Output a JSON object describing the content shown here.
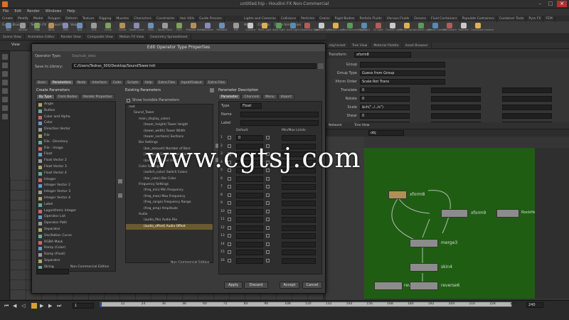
{
  "window": {
    "title": "untitled.hip - Houdini FX Non-Commercial"
  },
  "menu": [
    "File",
    "Edit",
    "Render",
    "Windows",
    "Help"
  ],
  "shelf_left": {
    "tabs": [
      "Create",
      "Modify",
      "Model",
      "Polygon",
      "Deform",
      "Texture",
      "Rigging",
      "Muscles",
      "Characters",
      "Constraints",
      "Hair Utils",
      "Guide Process",
      "Guide Brushes",
      "Terrain FX",
      "Cloud FX",
      "Volume"
    ],
    "tools": [
      "Box",
      "Sphere",
      "Tube",
      "Torus",
      "Grid",
      "Null",
      "Line",
      "Circle",
      "Curve",
      "Draw Curve",
      "Path",
      "Spray Paint",
      "Font",
      "Platonic Solids",
      "L-System",
      "Metaball",
      "File"
    ]
  },
  "shelf_right": {
    "tabs": [
      "Lights and Cameras",
      "Collisions",
      "Particles",
      "Grains",
      "Rigid Bodies",
      "Particle Fluids",
      "Viscous Fluids",
      "Oceans",
      "Fluid Containers",
      "Populate Containers",
      "Container Tools",
      "Pyro FX",
      "FEM",
      "Wires",
      "Crowds",
      "Drive Simulation"
    ],
    "tools": [
      "Camera",
      "Point Light",
      "Spot Light",
      "Area Light",
      "Geometry Light",
      "Volume Light",
      "Distant Light",
      "Environment Light",
      "Sky Light",
      "GI Light",
      "Caustic Light",
      "Portal Light",
      "Ambient Light",
      "Stereo Camera",
      "VR Camera",
      "Switcher",
      "Gamepad Camera"
    ]
  },
  "pane_tabs_left": [
    "Scene View",
    "Animation Editor",
    "Render View",
    "Composite View",
    "Motion FX View",
    "Geometry Spreadsheet"
  ],
  "pane_tabs_right": [
    "/obj/rocket",
    "Tree View",
    "Material Palette",
    "Asset Browser"
  ],
  "dialog": {
    "title": "Edit Operator Type Properties",
    "operator_type_label": "Operator Type:",
    "operator_type_value": "Sop/sub_desc",
    "save_to_library_label": "Save to Library:",
    "save_to_library_value": "C:/Users/Tedras_300/Desktop/SoundTower.hdt",
    "tabs": [
      "Basic",
      "Parameters",
      "Node",
      "Interface",
      "Code",
      "Scripts",
      "Help",
      "Extra Files",
      "Input/Output",
      "Extra Files"
    ],
    "create_params_title": "Create Parameters",
    "create_params_subtabs": [
      "By Type",
      "From Nodes",
      "Render Properties"
    ],
    "param_types": [
      "Angle",
      "Button",
      "Color and Alpha",
      "Color",
      "Direction Vector",
      "File",
      "File - Directory",
      "File - Image",
      "Float",
      "Float Vector 2",
      "Float Vector 3",
      "Float Vector 4",
      "Integer",
      "Integer Vector 2",
      "Integer Vector 3",
      "Integer Vector 4",
      "Label",
      "Logarithmic Integer",
      "Operator List",
      "Operator Path",
      "Separator",
      "Oscillation Curve",
      "RGBA Mask",
      "Ramp (Color)",
      "Ramp (Float)",
      "Separator",
      "String",
      "Toggle",
      "UV",
      "UVW"
    ],
    "create_params_footer": "Non-Commercial Edition",
    "existing_params_title": "Existing Parameters",
    "show_invisible_label": "Show Invisible Parameters",
    "tree": [
      "root",
      "Sound_Tower",
      "main_display_colors",
      "(tower_height) Tower Height",
      "(tower_width) Tower Width",
      "(tower_sections) Sections",
      "Bar Settings",
      "(bar_amount) Number of Bars",
      "(bar_gap) Gap Between Bars",
      "(bar_height) Bar Height",
      "Color Settings",
      "(switch_color) Switch Colors",
      "(bar_color) Bar Color",
      "Frequency Settings",
      "(freq_min) Min Frequency",
      "(freq_max) Max Frequency",
      "(freq_range) Frequency Range",
      "(freq_amp) Amplitude",
      "Audio",
      "(audio_file) Audio File",
      "(audio_offset) Audio Offset"
    ],
    "existing_params_footer": "Non-Commercial Edition",
    "param_desc_title": "Parameter Description",
    "param_desc_subtabs": [
      "Parameter",
      "Channels",
      "Menu",
      "Import"
    ],
    "param_desc_fields": [
      {
        "label": "Type",
        "value": "Float"
      },
      {
        "label": "Name",
        "value": ""
      },
      {
        "label": "Label",
        "value": ""
      }
    ],
    "channel_headers": [
      "Default",
      "Min/Max Limits"
    ],
    "channel_rows": [
      "1",
      "2",
      "3",
      "4",
      "5",
      "6",
      "7",
      "8",
      "9",
      "10",
      "11",
      "12",
      "13",
      "14",
      "15",
      "16"
    ],
    "buttons": {
      "apply": "Apply",
      "discard": "Discard",
      "accept": "Accept",
      "cancel": "Cancel"
    }
  },
  "right_params": {
    "node_name_label": "Transform",
    "node_name": "xform8",
    "rows": [
      {
        "label": "Group",
        "value": ""
      },
      {
        "label": "Group Type",
        "value": "Guess from Group"
      },
      {
        "label": "Xform Order",
        "value": "Scale Rot Trans"
      },
      {
        "label": "Translate",
        "value": "0"
      },
      {
        "label": "Rotate",
        "value": "0"
      },
      {
        "label": "Scale",
        "value": "$ch(\"../../s\")"
      },
      {
        "label": "Shear",
        "value": "0"
      },
      {
        "label": "Pivot",
        "value": "0"
      }
    ],
    "rot_order": "Rx Ry Rz"
  },
  "network": {
    "path": "obj",
    "nodes": [
      {
        "label": "xform8",
        "color": "#b0905a"
      },
      {
        "label": "xform9",
        "color": "#8c8c8c"
      },
      {
        "label": "RockHeight",
        "color": "#8c8c8c"
      },
      {
        "label": "merge3",
        "color": "#8c8c8c"
      },
      {
        "label": "skin4",
        "color": "#8c8c8c"
      },
      {
        "label": "reverse6",
        "color": "#8c8c8c"
      },
      {
        "label": "rev",
        "color": "#8c8c8c"
      }
    ]
  },
  "timeline": {
    "ticks": [
      "1",
      "12",
      "24",
      "36",
      "48",
      "60",
      "72",
      "84",
      "96",
      "108",
      "120",
      "132",
      "144",
      "156",
      "168",
      "180",
      "192",
      "204",
      "216",
      "228",
      "240"
    ],
    "current_frame": "1",
    "end_frame": "240"
  },
  "watermark": "www.cgtsj.com",
  "colors": {
    "network_bg": "#1f5e12",
    "selection": "#6b5a2e"
  }
}
